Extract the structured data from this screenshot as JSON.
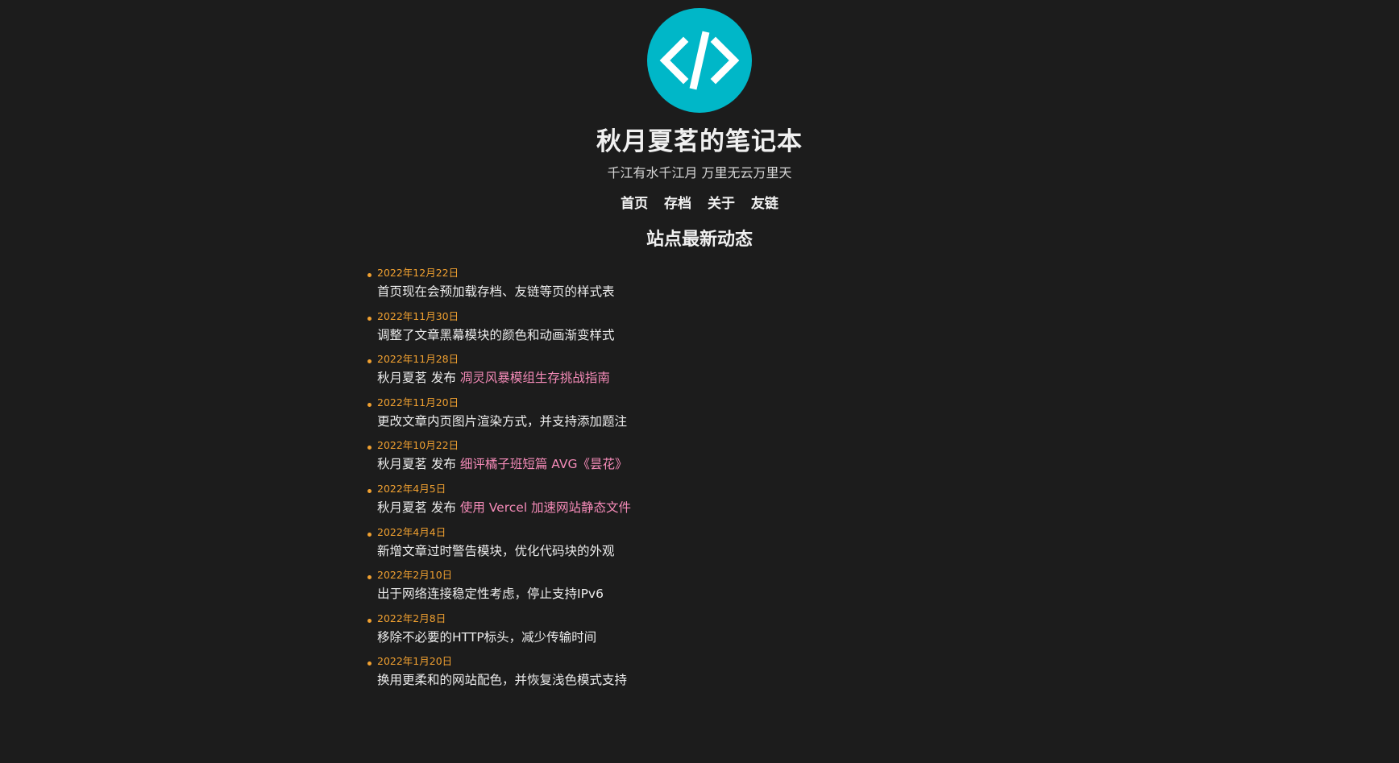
{
  "site": {
    "title": "秋月夏茗的笔记本",
    "subtitle": "千江有水千江月 万里无云万里天",
    "logo_icon": "code-brackets-icon",
    "logo_color": "#00b7c8"
  },
  "nav": {
    "items": [
      {
        "label": "首页"
      },
      {
        "label": "存档"
      },
      {
        "label": "关于"
      },
      {
        "label": "友链"
      }
    ]
  },
  "updates_section": {
    "title": "站点最新动态",
    "date_color": "#f0a030",
    "link_color": "#f58bb8",
    "items": [
      {
        "date": "2022年12月22日",
        "text": "首页现在会预加载存档、友链等页的样式表",
        "link": ""
      },
      {
        "date": "2022年11月30日",
        "text": "调整了文章黑幕模块的颜色和动画渐变样式",
        "link": ""
      },
      {
        "date": "2022年11月28日",
        "text": "秋月夏茗 发布 ",
        "link": "凋灵风暴模组生存挑战指南"
      },
      {
        "date": "2022年11月20日",
        "text": "更改文章内页图片渲染方式，并支持添加题注",
        "link": ""
      },
      {
        "date": "2022年10月22日",
        "text": "秋月夏茗 发布 ",
        "link": "细评橘子班短篇 AVG《昙花》"
      },
      {
        "date": "2022年4月5日",
        "text": "秋月夏茗 发布 ",
        "link": "使用 Vercel 加速网站静态文件"
      },
      {
        "date": "2022年4月4日",
        "text": "新增文章过时警告模块，优化代码块的外观",
        "link": ""
      },
      {
        "date": "2022年2月10日",
        "text": "出于网络连接稳定性考虑，停止支持IPv6",
        "link": ""
      },
      {
        "date": "2022年2月8日",
        "text": "移除不必要的HTTP标头，减少传输时间",
        "link": ""
      },
      {
        "date": "2022年1月20日",
        "text": "换用更柔和的网站配色，并恢复浅色模式支持",
        "link": ""
      }
    ]
  }
}
